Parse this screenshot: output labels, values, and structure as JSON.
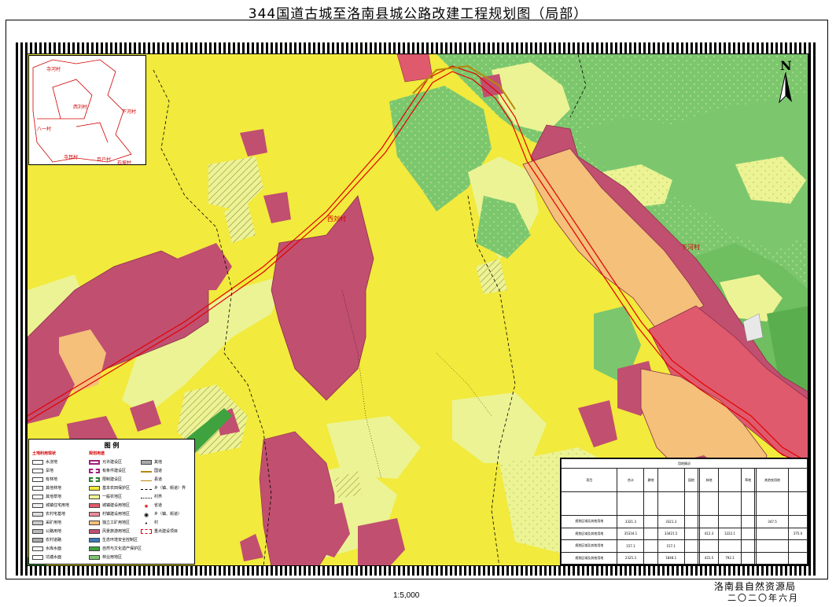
{
  "title": "344国道古城至洛南县城公路改建工程规划图（局部）",
  "scale": "1:5,000",
  "agency": "洛南县自然资源局",
  "date": "二〇二〇年六月",
  "north_label": "N",
  "villages": [
    "西刘村",
    "下河村"
  ],
  "inset_labels": [
    "寺河村",
    "西刘村",
    "下河村",
    "八一村",
    "寺耳村",
    "百户村",
    "石坡村"
  ],
  "legend": {
    "title": "图 例",
    "col1_header": "土地利用现状",
    "col2_header": "规划用途",
    "col2b_header": "土地利用规划",
    "col1": [
      "水浇地",
      "旱地",
      "有林地",
      "其他林地",
      "其他草地",
      "城镇住宅用地",
      "农村宅基地",
      "采矿用地",
      "公路用地",
      "农村道路",
      "水库水面",
      "坑塘水面"
    ],
    "col2": [
      "允许建设区",
      "有条件建设区",
      "限制建设区",
      "基本农田保护区",
      "一般农地区",
      "城镇建设用地区",
      "村镇建设用地区",
      "独立工矿用地区",
      "风景旅游用地区",
      "生态环境安全控制区",
      "自然与文化遗产保护区",
      "林业用地区"
    ],
    "col3": [
      "其他",
      "国道",
      "县道",
      "乡（镇、街道）界",
      "村界",
      "省道",
      "乡（镇、街道）",
      "村",
      "重点建设项目"
    ]
  },
  "table": {
    "title": "用地情况",
    "header": [
      "项目",
      "合计",
      "耕地",
      "",
      "园地",
      "",
      "林地",
      "",
      "草地",
      "",
      "其他农用地",
      ""
    ],
    "rows": [
      [
        "规划区域及其他用地",
        "3321.3",
        "",
        "3321.3",
        "",
        "",
        "",
        "",
        "",
        "",
        "347.5",
        ""
      ],
      [
        "规划区域及其他用地",
        "35334.1",
        "",
        "33421.5",
        "",
        "",
        "412.3",
        "1222.1",
        "",
        "",
        "",
        "375.0"
      ],
      [
        "规划区域及其他用地",
        "157.1",
        "",
        "157.1",
        "",
        "",
        "",
        "",
        "",
        "",
        "",
        ""
      ],
      [
        "规划区域及其他用地",
        "2325.3",
        "",
        "1848.1",
        "",
        "",
        "431.5",
        "792.1",
        "",
        "",
        "",
        ""
      ]
    ]
  },
  "colors": {
    "general_farmland": "#f2ea3c",
    "basic_farmland": "#ecf394",
    "forest": "#7cc76e",
    "forest_dark": "#5aae4e",
    "village": "#c14f70",
    "town": "#df5a6c",
    "orange_zone": "#f4c07a",
    "road_red": "#e30000",
    "road_green": "#3ea33e"
  }
}
